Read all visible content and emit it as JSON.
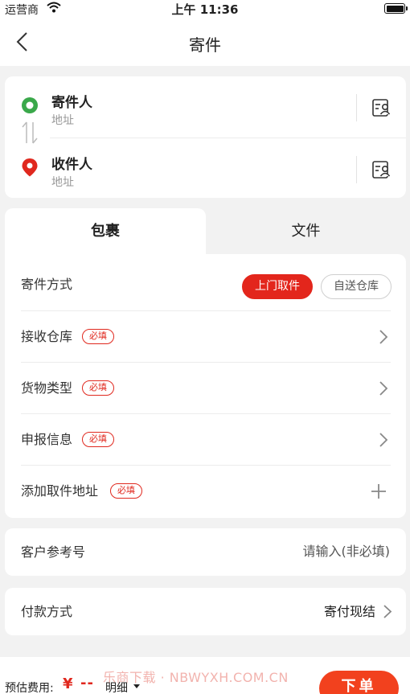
{
  "status_bar": {
    "carrier": "运营商",
    "time": "上午 11:36"
  },
  "nav": {
    "title": "寄件"
  },
  "sender": {
    "name": "寄件人",
    "address": "地址"
  },
  "receiver": {
    "name": "收件人",
    "address": "地址"
  },
  "tabs": [
    {
      "label": "包裹",
      "active": true
    },
    {
      "label": "文件",
      "active": false
    }
  ],
  "form": {
    "method": {
      "label": "寄件方式",
      "options": [
        "上门取件",
        "自送仓库"
      ],
      "selected": "上门取件"
    },
    "rows": [
      {
        "label": "接收仓库",
        "badge": "必填"
      },
      {
        "label": "货物类型",
        "badge": "必填"
      },
      {
        "label": "申报信息",
        "badge": "必填"
      },
      {
        "label": "添加取件地址",
        "badge": "必填"
      }
    ]
  },
  "reference": {
    "label": "客户参考号",
    "placeholder": "请输入(非必填)"
  },
  "payment": {
    "label": "付款方式",
    "value": "寄付现结"
  },
  "bottom": {
    "estimate_label": "预估费用:",
    "currency": "¥",
    "amount": "--",
    "detail_label": "明细",
    "order_label": "下单",
    "watermark": "乐商下载 · NBWYXH.COM.CN"
  },
  "colors": {
    "accent": "#e3261c",
    "sender_pin": "#3aa84a",
    "receiver_pin": "#e0281e",
    "order_button": "#f2411e"
  },
  "icons": [
    "back-chevron-icon",
    "wifi-icon",
    "battery-icon",
    "sender-pin-icon",
    "receiver-pin-icon",
    "swap-icon",
    "address-book-icon",
    "chevron-right-icon",
    "plus-icon",
    "caret-down-icon"
  ]
}
